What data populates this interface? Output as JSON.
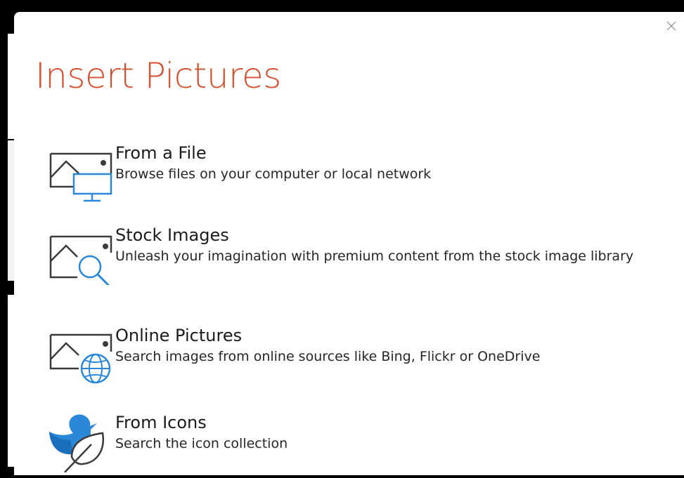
{
  "dialog": {
    "title": "Insert Pictures",
    "close_icon": "close-icon",
    "accent_color": "#d35230",
    "icon_blue": "#2b88d8"
  },
  "options": [
    {
      "label": "From a File",
      "description": "Browse files on your computer or local network",
      "icon": "picture-monitor-icon"
    },
    {
      "label": "Stock Images",
      "description": "Unleash your imagination with premium content from the stock image library",
      "icon": "picture-magnifier-icon"
    },
    {
      "label": "Online Pictures",
      "description": "Search images from online sources like Bing, Flickr or OneDrive",
      "icon": "picture-globe-icon"
    },
    {
      "label": "From Icons",
      "description": "Search the icon collection",
      "icon": "bird-leaf-icon"
    }
  ]
}
